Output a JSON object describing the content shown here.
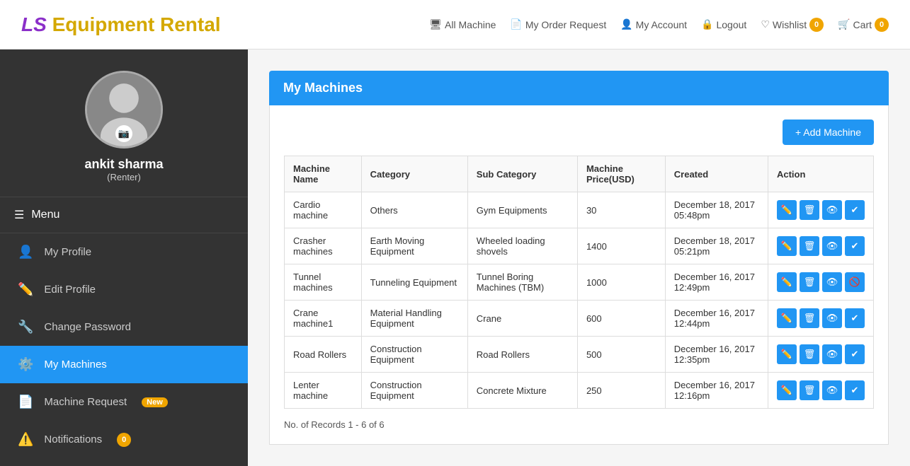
{
  "header": {
    "logo_ls": "LS",
    "logo_eq": "Equipment Rental",
    "nav": [
      {
        "label": "All Machine",
        "icon": "🖥"
      },
      {
        "label": "My Order Request",
        "icon": "📄"
      },
      {
        "label": "My Account",
        "icon": "👤"
      },
      {
        "label": "Logout",
        "icon": "🔒"
      },
      {
        "label": "Wishlist",
        "icon": "♡",
        "badge": "0"
      },
      {
        "label": "Cart",
        "icon": "🛒",
        "badge": "0"
      }
    ]
  },
  "sidebar": {
    "user_name": "ankit sharma",
    "user_role": "(Renter)",
    "menu_label": "Menu",
    "items": [
      {
        "label": "My Profile",
        "icon": "👤",
        "active": false
      },
      {
        "label": "Edit Profile",
        "icon": "✏️",
        "active": false
      },
      {
        "label": "Change Password",
        "icon": "🔧",
        "active": false
      },
      {
        "label": "My Machines",
        "icon": "⚙️",
        "active": true
      },
      {
        "label": "Machine Request",
        "icon": "📄",
        "active": false,
        "badge": "New"
      },
      {
        "label": "Notifications",
        "icon": "⚠️",
        "active": false,
        "badge": "0"
      }
    ]
  },
  "main": {
    "section_title": "My Machines",
    "add_button": "+ Add Machine",
    "table": {
      "columns": [
        "Machine Name",
        "Category",
        "Sub Category",
        "Machine Price(USD)",
        "Created",
        "Action"
      ],
      "rows": [
        {
          "machine_name": "Cardio machine",
          "category": "Others",
          "sub_category": "Gym Equipments",
          "price": "30",
          "created": "December 18, 2017 05:48pm",
          "actions": [
            "edit",
            "delete",
            "view",
            "check"
          ]
        },
        {
          "machine_name": "Crasher machines",
          "category": "Earth Moving Equipment",
          "sub_category": "Wheeled loading shovels",
          "price": "1400",
          "created": "December 18, 2017 05:21pm",
          "actions": [
            "edit",
            "delete",
            "view",
            "check"
          ]
        },
        {
          "machine_name": "Tunnel machines",
          "category": "Tunneling Equipment",
          "sub_category": "Tunnel Boring Machines (TBM)",
          "price": "1000",
          "created": "December 16, 2017 12:49pm",
          "actions": [
            "edit",
            "delete",
            "view",
            "block"
          ]
        },
        {
          "machine_name": "Crane machine1",
          "category": "Material Handling Equipment",
          "sub_category": "Crane",
          "price": "600",
          "created": "December 16, 2017 12:44pm",
          "actions": [
            "edit",
            "delete",
            "view",
            "check"
          ]
        },
        {
          "machine_name": "Road Rollers",
          "category": "Construction Equipment",
          "sub_category": "Road Rollers",
          "price": "500",
          "created": "December 16, 2017 12:35pm",
          "actions": [
            "edit",
            "delete",
            "view",
            "check"
          ]
        },
        {
          "machine_name": "Lenter machine",
          "category": "Construction Equipment",
          "sub_category": "Concrete Mixture",
          "price": "250",
          "created": "December 16, 2017 12:16pm",
          "actions": [
            "edit",
            "delete",
            "view",
            "check"
          ]
        }
      ]
    },
    "records_text": "No. of Records 1 - 6 of 6"
  }
}
